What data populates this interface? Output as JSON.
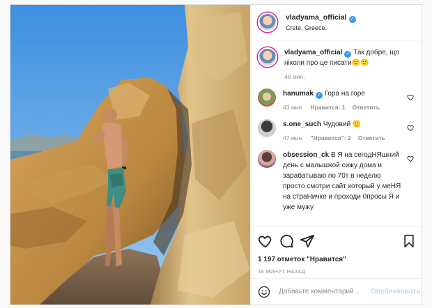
{
  "header": {
    "username": "vladyama_official",
    "location": "Crete, Greece."
  },
  "caption": {
    "username": "vladyama_official",
    "text": "Так добре, що ніколи про це писати🙂🙂",
    "time": "48 мин."
  },
  "comments": [
    {
      "username": "hanumak",
      "verified": true,
      "text": "Гора на горе",
      "time": "43 мин.",
      "likes": "Нравится: 1",
      "reply": "Ответить"
    },
    {
      "username": "s.one_such",
      "verified": false,
      "text": "Чудовий 🙂",
      "time": "47 мин.",
      "likes": "\"Нравится\": 2",
      "reply": "Ответить"
    },
    {
      "username": "obsession_ck",
      "verified": false,
      "text": "Ƀ Я на сегодНЯшний день с малышкой сижу дома и зарабатываю по 70т в неделю просто смотри сайт который у меНЯ на страНичке и проходи 0просы Я и уже мужу"
    }
  ],
  "likes_text": "1 197 отметок \"Нравится\"",
  "posted_time": "48 МИНУТ НАЗАД",
  "add_comment": {
    "placeholder": "Добавьте комментарий...",
    "publish_label": "Опубликовать"
  },
  "colors": {
    "verified": "#3897f0",
    "publish_disabled": "#b3dbff",
    "meta_gray": "#8e8e8e"
  }
}
